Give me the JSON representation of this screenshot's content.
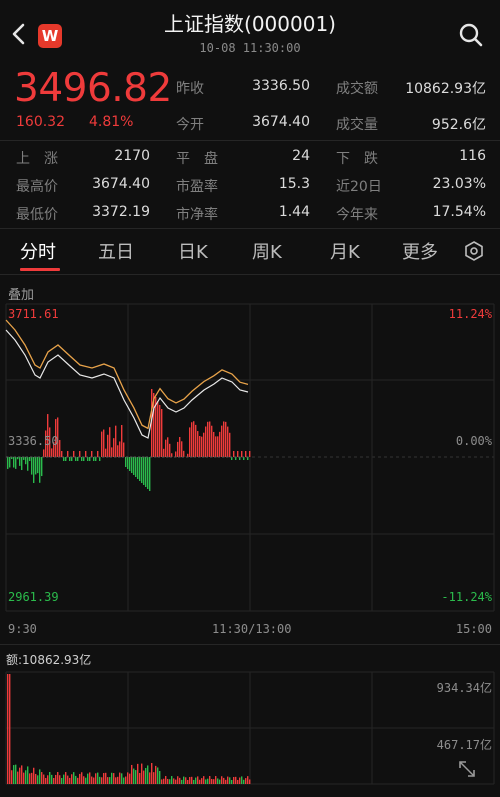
{
  "header": {
    "title": "上证指数(000001)",
    "subtitle": "10-08 11:30:00",
    "logo_text": "W"
  },
  "quote": {
    "price": "3496.82",
    "change": "160.32",
    "change_pct": "4.81%"
  },
  "stats_row1": [
    {
      "label": "昨收",
      "value": "3336.50"
    },
    {
      "label": "成交额",
      "value": "10862.93亿"
    }
  ],
  "stats_row2": [
    {
      "label": "今开",
      "value": "3674.40"
    },
    {
      "label": "成交量",
      "value": "952.6亿"
    }
  ],
  "grid": {
    "rows": [
      [
        {
          "label": "上　涨",
          "value": "2170"
        },
        {
          "label": "平　盘",
          "value": "24"
        },
        {
          "label": "下　跌",
          "value": "116"
        }
      ],
      [
        {
          "label": "最高价",
          "value": "3674.40"
        },
        {
          "label": "市盈率",
          "value": "15.3"
        },
        {
          "label": "近20日",
          "value": "23.03%"
        }
      ],
      [
        {
          "label": "最低价",
          "value": "3372.19"
        },
        {
          "label": "市净率",
          "value": "1.44"
        },
        {
          "label": "今年来",
          "value": "17.54%"
        }
      ]
    ]
  },
  "tabs": [
    "分时",
    "五日",
    "日K",
    "周K",
    "月K",
    "更多"
  ],
  "active_tab": "分时",
  "chart": {
    "overlay_label": "叠加",
    "y_top": "3711.61",
    "y_mid": "3336.50",
    "y_bottom": "2961.39",
    "pct_top": "11.24%",
    "pct_mid": "0.00%",
    "pct_bottom": "-11.24%",
    "x_start": "9:30",
    "x_mid": "11:30/13:00",
    "x_end": "15:00"
  },
  "volume": {
    "label": "额:10862.93亿",
    "y_top": "934.34亿",
    "y_mid": "467.17亿"
  },
  "colors": {
    "up": "#ef3b3b",
    "down": "#2bbb4c",
    "price_line": "#e8e8e8",
    "avg_line": "#e8a34a",
    "background": "#101010"
  },
  "icons": {
    "back": "chevron-left-icon",
    "search": "search-icon",
    "settings": "settings-hex-icon",
    "expand": "expand-icon"
  }
}
